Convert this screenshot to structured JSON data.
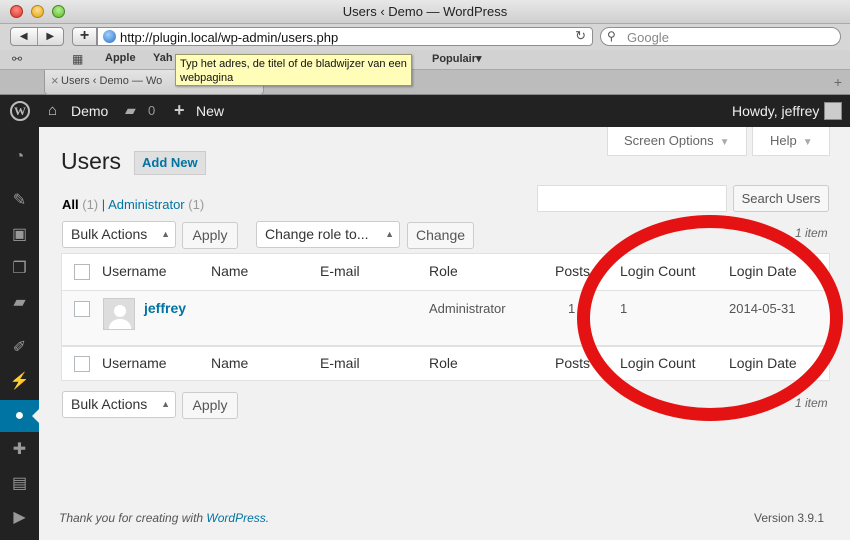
{
  "window": {
    "title": "Users ‹ Demo — WordPress"
  },
  "toolbar": {
    "back": "◀",
    "forward": "▶",
    "add": "+",
    "url": "http://plugin.local/wp-admin/users.php",
    "reload": "↻",
    "search_placeholder": "Google"
  },
  "bookmarks": [
    "Apple",
    "Yah",
    "Populair"
  ],
  "tooltip": "Typ het adres, de titel of de bladwijzer van een webpagina",
  "tab": {
    "label": "Users ‹ Demo — Wo",
    "close": "×",
    "new": "+"
  },
  "adminbar": {
    "site": "Demo",
    "comments": "0",
    "new": "New",
    "howdy": "Howdy, jeffrey"
  },
  "content": {
    "screen_options": "Screen Options",
    "help": "Help",
    "title": "Users",
    "add_new": "Add New",
    "filters": {
      "all": "All",
      "all_count": "(1)",
      "separator": "|",
      "admin": "Administrator",
      "admin_count": "(1)"
    },
    "search_button": "Search Users",
    "bulk_actions": "Bulk Actions",
    "apply": "Apply",
    "change_role": "Change role to...",
    "change": "Change",
    "item_count": "1 item",
    "columns": [
      "Username",
      "Name",
      "E-mail",
      "Role",
      "Posts",
      "Login Count",
      "Login Date"
    ],
    "row": {
      "username": "jeffrey",
      "name": "",
      "email": "",
      "role": "Administrator",
      "posts": "1",
      "login_count": "1",
      "login_date": "2014-05-31"
    },
    "footer_thanks": "Thank you for creating with",
    "footer_link": "WordPress.",
    "version": "Version 3.9.1"
  },
  "colors": {
    "admin_link": "#0074a2",
    "annotation": "#e41212",
    "adminbar_bg": "#222222"
  }
}
